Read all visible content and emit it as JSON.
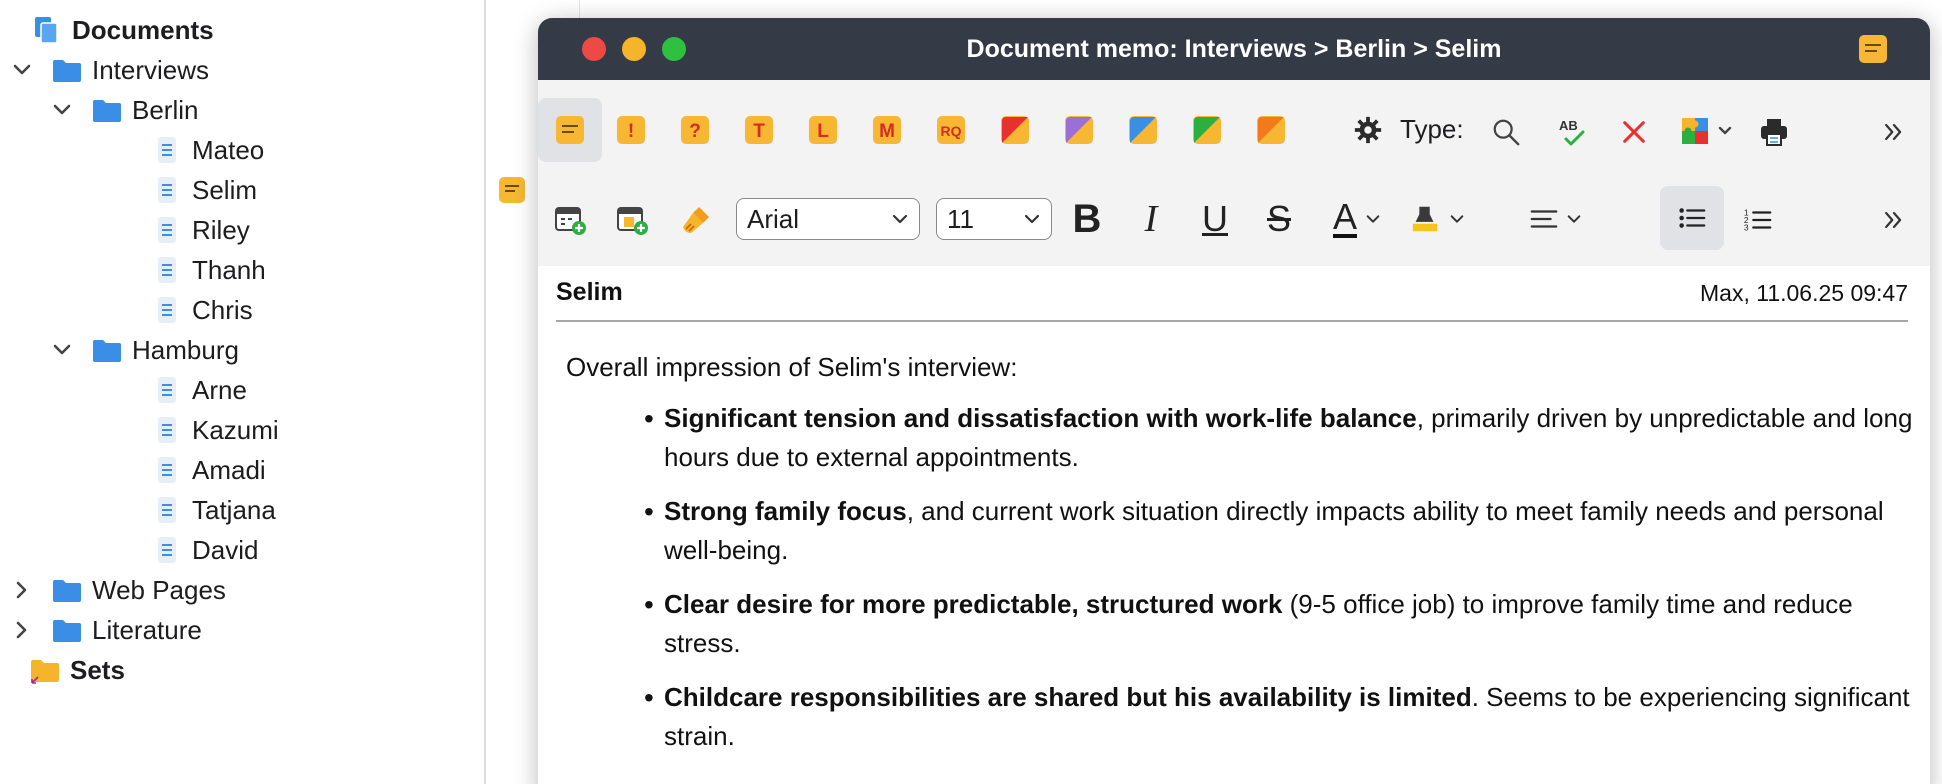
{
  "tree": {
    "root_label": "Documents",
    "interviews_label": "Interviews",
    "berlin_label": "Berlin",
    "berlin_docs": [
      "Mateo",
      "Selim",
      "Riley",
      "Thanh",
      "Chris"
    ],
    "hamburg_label": "Hamburg",
    "hamburg_docs": [
      "Arne",
      "Kazumi",
      "Amadi",
      "Tatjana",
      "David"
    ],
    "web_pages_label": "Web Pages",
    "literature_label": "Literature",
    "sets_label": "Sets"
  },
  "window": {
    "title": "Document memo: Interviews > Berlin > Selim"
  },
  "toolbar": {
    "memo_type_letters": [
      "!",
      "?",
      "T",
      "L",
      "M",
      "RQ"
    ],
    "type_label": "Type:",
    "font_name": "Arial",
    "font_size": "11",
    "bold_glyph": "B",
    "italic_glyph": "I",
    "underline_glyph": "U",
    "strike_glyph": "S",
    "font_color_glyph": "A"
  },
  "memo": {
    "name": "Selim",
    "meta": "Max, 11.06.25 09:47",
    "intro": "Overall impression of Selim's interview:",
    "points": [
      {
        "bold": "Significant tension and dissatisfaction with work-life balance",
        "rest": ", primarily driven by unpredictable and long hours due to external appointments."
      },
      {
        "bold": "Strong family focus",
        "rest": ", and current work situation directly impacts ability to meet family needs and personal well-being."
      },
      {
        "bold": "Clear desire for more predictable, structured work",
        "rest": " (9-5 office job) to improve family time and reduce stress."
      },
      {
        "bold": "Childcare responsibilities are shared but his availability is limited",
        "rest": ". Seems to be experiencing significant strain."
      }
    ]
  },
  "colors": {
    "titlebar": "#343a46",
    "memo_yellow": "#f7b733",
    "folder_blue": "#3a8ee6",
    "close_red": "#ed4a45",
    "minimize_yellow": "#f5b42a",
    "zoom_green": "#2ec140"
  },
  "icons": {
    "tree_root": "documents-icon",
    "folder": "folder-icon",
    "document": "document-icon",
    "sets": "sets-folder-icon",
    "expand": "chevron-down-icon",
    "collapse": "chevron-right-icon"
  }
}
